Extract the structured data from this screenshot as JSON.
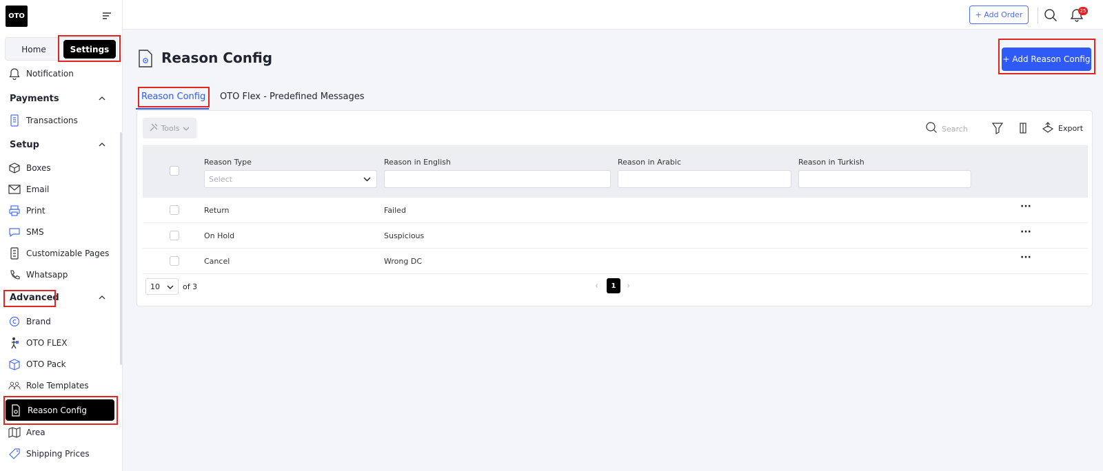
{
  "brand": {
    "logo_text": "OTO"
  },
  "switcher": {
    "home": "Home",
    "settings": "Settings"
  },
  "sidebar": {
    "notification": "Notification",
    "payments": {
      "title": "Payments",
      "items": [
        "Transactions"
      ]
    },
    "setup": {
      "title": "Setup",
      "items": [
        "Boxes",
        "Email",
        "Print",
        "SMS",
        "Customizable Pages",
        "Whatsapp"
      ]
    },
    "advanced": {
      "title": "Advanced",
      "items": [
        "Brand",
        "OTO FLEX",
        "OTO Pack",
        "Role Templates",
        "Reason Config",
        "Area",
        "Shipping Prices"
      ]
    }
  },
  "topbar": {
    "add_order": "+ Add Order",
    "notification_count": "25"
  },
  "page": {
    "title": "Reason Config",
    "add_button": "+ Add Reason Config"
  },
  "tabs": [
    "Reason Config",
    "OTO Flex - Predefined Messages"
  ],
  "toolbar": {
    "tools": "Tools",
    "search_placeholder": "Search",
    "export": "Export"
  },
  "table": {
    "columns": [
      "Reason Type",
      "Reason in English",
      "Reason in Arabic",
      "Reason in Turkish"
    ],
    "type_filter_placeholder": "Select",
    "rows": [
      {
        "type": "Return",
        "english": "Failed"
      },
      {
        "type": "On Hold",
        "english": "Suspicious"
      },
      {
        "type": "Cancel",
        "english": "Wrong DC"
      }
    ]
  },
  "pagination": {
    "page_size": "10",
    "of_text": "of 3",
    "current_page": "1"
  },
  "colors": {
    "accent": "#2f5af7",
    "highlight": "#e02424",
    "active_bg": "#000000"
  }
}
